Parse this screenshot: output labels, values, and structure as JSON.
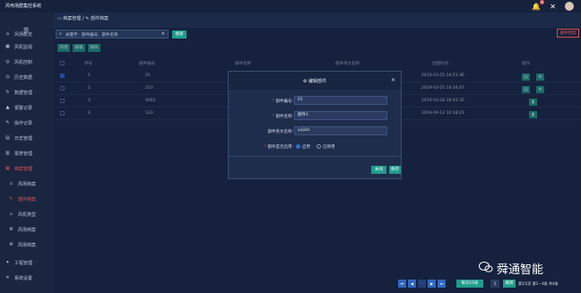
{
  "app": {
    "title": "风电场群集控系统"
  },
  "topbar": {
    "notification_count": "9",
    "hamburger": "☰"
  },
  "sidebar": {
    "items": [
      {
        "label": "风场概览",
        "icon": "home-icon"
      },
      {
        "label": "风机监视",
        "icon": "monitor-icon"
      },
      {
        "label": "风机控制",
        "icon": "control-icon"
      },
      {
        "label": "历史数据",
        "icon": "history-icon"
      },
      {
        "label": "数据管理",
        "icon": "data-icon"
      },
      {
        "label": "报警记录",
        "icon": "alarm-icon"
      },
      {
        "label": "操作记录",
        "icon": "log-icon"
      },
      {
        "label": "日志管理",
        "icon": "journal-icon"
      },
      {
        "label": "报表管理",
        "icon": "report-icon"
      },
      {
        "label": "档案管理",
        "icon": "archive-icon"
      }
    ],
    "subitems": [
      {
        "label": "风场档案"
      },
      {
        "label": "部件档案"
      },
      {
        "label": "风机类型"
      },
      {
        "label": "风场档案"
      },
      {
        "label": "风场档案"
      }
    ],
    "bottom": [
      {
        "label": "工程管理"
      },
      {
        "label": "系统设置"
      }
    ]
  },
  "breadcrumb": {
    "root": "档案管理",
    "current": "部件档案"
  },
  "tabs": {
    "active": "部件档案"
  },
  "search": {
    "placeholder": "关键字：部件编号、部件名称",
    "button": "搜索"
  },
  "toolbar": {
    "add": "新增",
    "edit": "编辑",
    "delete": "删除"
  },
  "table": {
    "headers": [
      "序号",
      "部件编号",
      "部件名称",
      "部件英文名称",
      "创建时间",
      "操作"
    ],
    "rows": [
      {
        "index": "1",
        "code": "01",
        "time": "2019-03-25 14:21:36",
        "checked": true
      },
      {
        "index": "2",
        "code": "223",
        "time": "2019-03-25 14:34:47",
        "checked": false
      },
      {
        "index": "3",
        "code": "0002",
        "time": "2019-03-28 16:45:35",
        "checked": false
      },
      {
        "index": "4",
        "code": "123",
        "time": "2019-04-12 10:18:21",
        "checked": false
      }
    ]
  },
  "modal": {
    "title": "编辑部件",
    "fields": {
      "code_label": "部件编号:",
      "code_value": "01",
      "name_label": "部件名称:",
      "name_value": "部件1",
      "en_label": "部件英文名称:",
      "en_value": "yujian",
      "enabled_label": "部件是否启用:",
      "opt_yes": "启用",
      "opt_no": "已停用"
    },
    "cancel": "关闭",
    "save": "保存"
  },
  "pagination": {
    "per_page": "每页10条",
    "page_input": "1",
    "go": "跳转",
    "summary": "第1/1页 第1－4条 共4条"
  },
  "watermark": {
    "text": "舜通智能"
  }
}
